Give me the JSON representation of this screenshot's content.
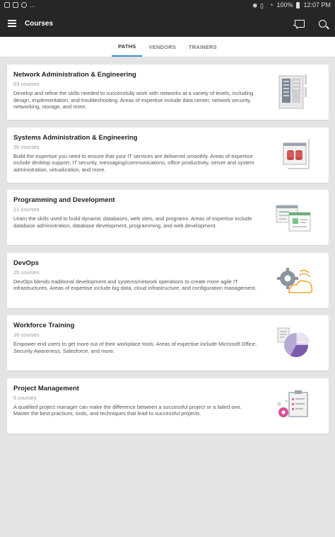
{
  "status_bar": {
    "battery": "100%",
    "time": "12:07 PM",
    "overflow": "..."
  },
  "app_bar": {
    "title": "Courses"
  },
  "tabs": [
    {
      "label": "PATHS",
      "active": true
    },
    {
      "label": "VENDORS",
      "active": false
    },
    {
      "label": "TRAINERS",
      "active": false
    }
  ],
  "paths": [
    {
      "title": "Network Administration & Engineering",
      "count": "63 courses",
      "description": "Develop and refine the skills needed to successfully work with networks at a variety of levels, including design, implementation, and troubleshooting. Areas of expertise include data center, network security, networking, storage, and more."
    },
    {
      "title": "Systems Administration & Engineering",
      "count": "36 courses",
      "description": "Build the expertise you need to ensure that your IT services are delivered smoothly. Areas of expertise include desktop support, IT security, messaging/communications, office productivity, server and system administration, virtualization, and more."
    },
    {
      "title": "Programming and Development",
      "count": "21 courses",
      "description": "Learn the skills used to build dynamic databases, web sites, and programs. Areas of expertise include database administration, database development, programming, and web development."
    },
    {
      "title": "DevOps",
      "count": "25 courses",
      "description": "DevOps blends traditional development and systems/network operations to create more agile IT infrastructures. Areas of expertise include big data, cloud infrastructure, and configuration management."
    },
    {
      "title": "Workforce Training",
      "count": "16 courses",
      "description": "Empower end users to get more out of their workplace tools. Areas of expertise include Microsoft Office, Security Awareness, Salesforce, and more."
    },
    {
      "title": "Project Management",
      "count": "6 courses",
      "description": "A qualified project manager can make the difference between a successful project or a failed one. Master the best practices, tools, and techniques that lead to successful projects."
    }
  ],
  "icons": [
    "server-rack-icon",
    "database-icon",
    "code-window-icon",
    "cloud-gear-icon",
    "pie-chart-icon",
    "checklist-icon"
  ],
  "colors": {
    "bar": "#262626",
    "tab_indicator": "#3a8fd4",
    "background": "#e4e4e4"
  }
}
